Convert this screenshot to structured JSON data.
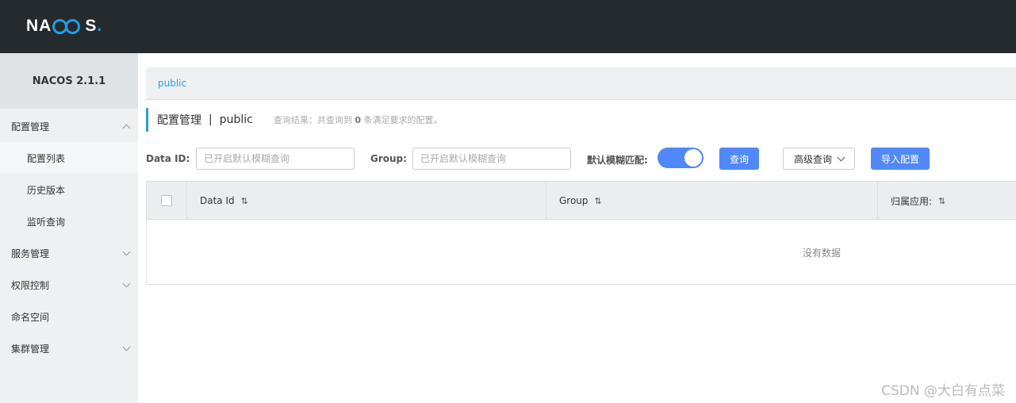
{
  "brand": {
    "logo_left": "NA",
    "logo_right": "S",
    "logo_dot": "."
  },
  "sidebar": {
    "version": "NACOS 2.1.1",
    "items": [
      {
        "label": "配置管理",
        "expanded": true
      },
      {
        "label": "配置列表",
        "sub": true,
        "active": true
      },
      {
        "label": "历史版本",
        "sub": true
      },
      {
        "label": "监听查询",
        "sub": true
      },
      {
        "label": "服务管理"
      },
      {
        "label": "权限控制"
      },
      {
        "label": "命名空间"
      },
      {
        "label": "集群管理"
      }
    ]
  },
  "breadcrumb": {
    "namespace": "public"
  },
  "page": {
    "title": "配置管理",
    "separator": "|",
    "namespace": "public",
    "hint_prefix": "查询结果：共查询到",
    "hint_count": "0",
    "hint_suffix": "条满足要求的配置。"
  },
  "search": {
    "dataid_label": "Data ID:",
    "dataid_placeholder": "已开启默认模糊查询",
    "group_label": "Group:",
    "group_placeholder": "已开启默认模糊查询",
    "fuzzy_label": "默认模糊匹配:",
    "fuzzy_on": true,
    "query_button": "查询",
    "advanced_button": "高级查询",
    "import_button": "导入配置"
  },
  "table": {
    "columns": [
      "Data Id",
      "Group",
      "归属应用:"
    ],
    "sort_icon": "⇅",
    "empty_text": "没有数据"
  },
  "watermark": "CSDN @大白有点菜",
  "colors": {
    "topbar": "#252a2f",
    "accent": "#5089f7",
    "link": "#1fa2e0",
    "logo_ring": "#1f9fe6"
  }
}
